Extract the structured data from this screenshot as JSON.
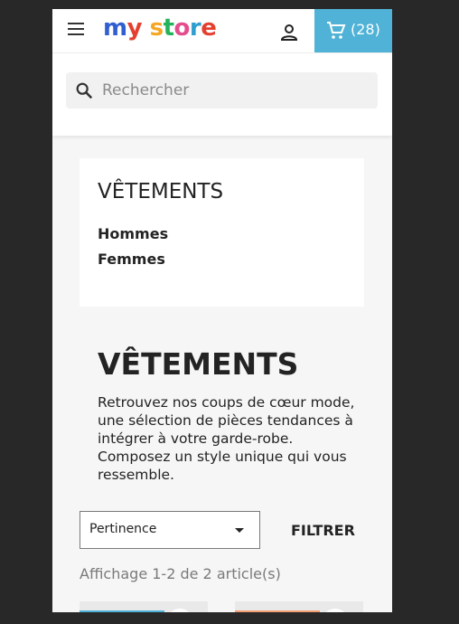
{
  "header": {
    "logo": {
      "m": "m",
      "y": "y",
      "s": "s",
      "t": "t",
      "o": "o",
      "r": "r",
      "e": "e"
    },
    "cart_count": "(28)"
  },
  "search": {
    "placeholder": "Rechercher"
  },
  "category_block": {
    "title": "VÊTEMENTS",
    "links": [
      "Hommes",
      "Femmes"
    ]
  },
  "main": {
    "title": "VÊTEMENTS",
    "description": "Retrouvez nos coups de cœur mode, une sélection de pièces tendances à intégrer à votre garde-robe. Composez un style unique qui vous ressemble."
  },
  "sort": {
    "selected": "Pertinence"
  },
  "filter_label": "FILTRER",
  "results_count": "Affichage 1-2 de 2 article(s)",
  "colors": {
    "accent": "#4fb2d6",
    "stripe1": "#4fb2d6",
    "stripe2": "#f39d72"
  }
}
